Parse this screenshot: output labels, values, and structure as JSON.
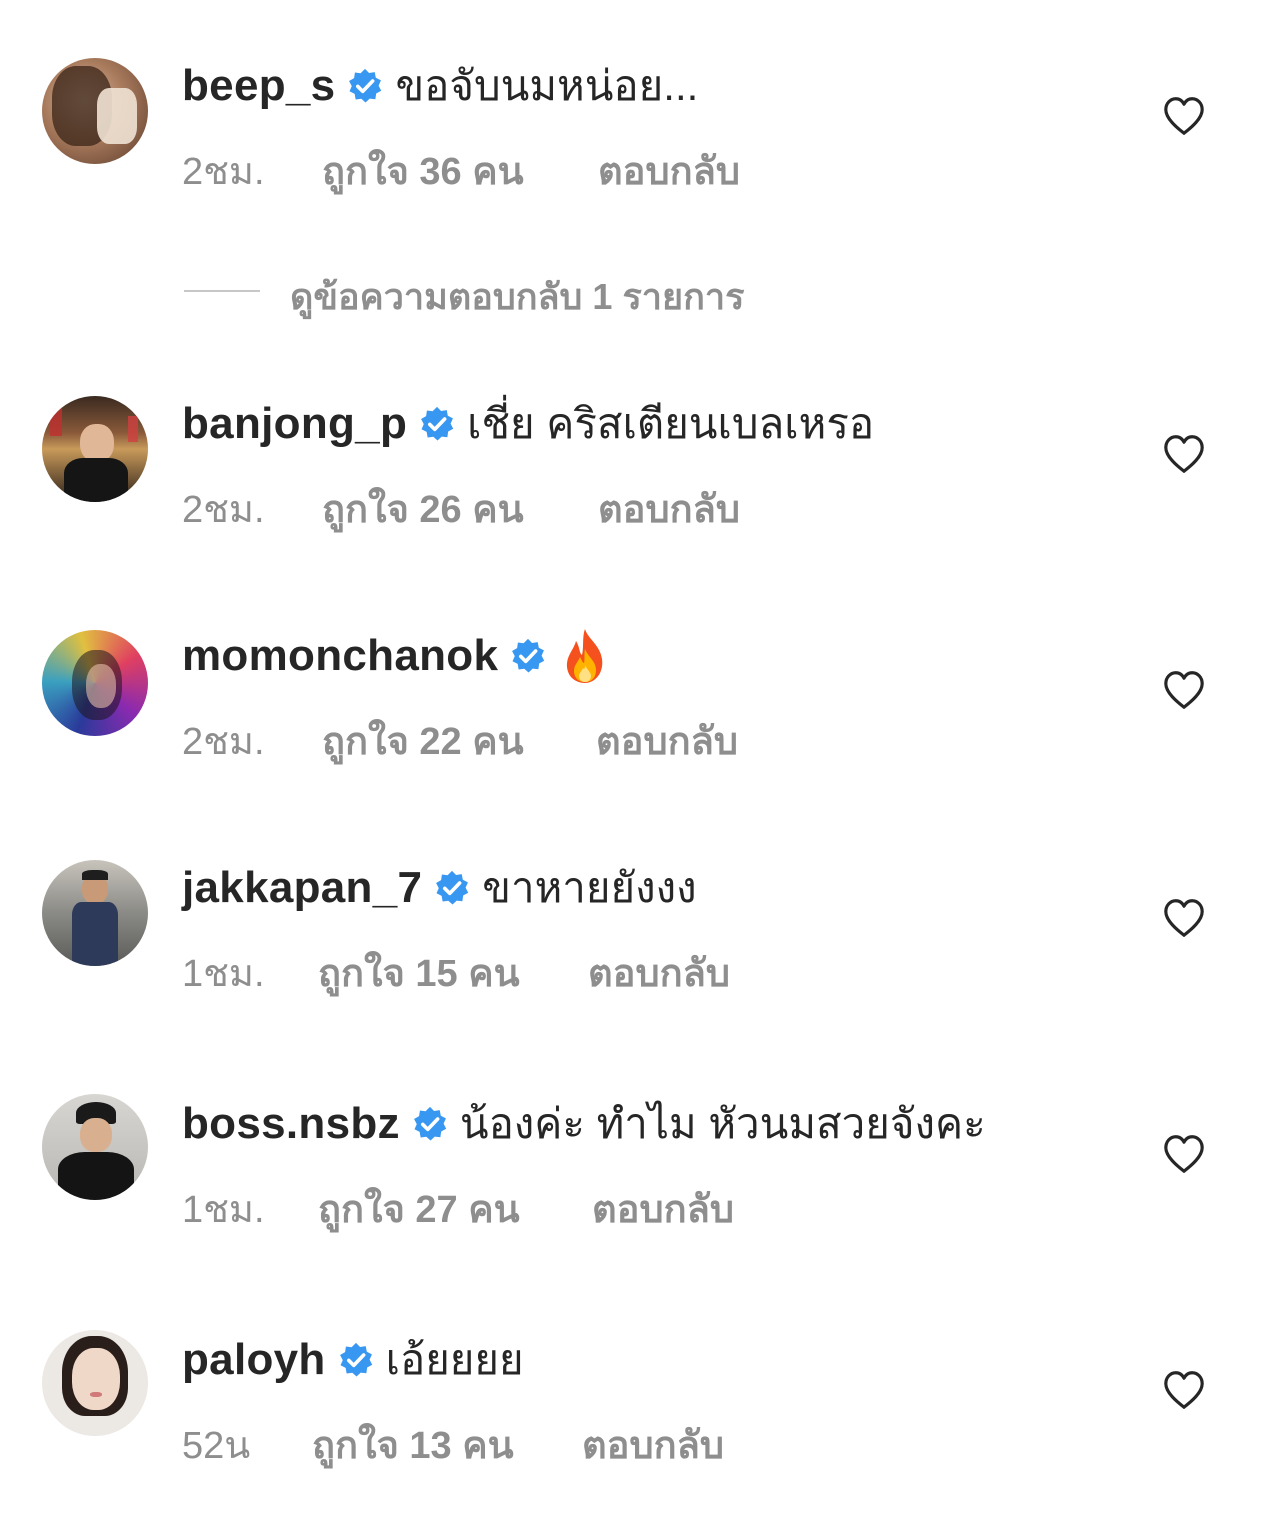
{
  "comments": [
    {
      "username": "beep_s",
      "text": "ขอจับนมหน่อย...",
      "time": "2ชม.",
      "likes": "ถูกใจ 36 คน",
      "reply": "ตอบกลับ",
      "view_replies": "ดูข้อความตอบกลับ 1 รายการ"
    },
    {
      "username": "banjong_p",
      "text": "เชี่ย คริสเตียนเบลเหรอ",
      "time": "2ชม.",
      "likes": "ถูกใจ 26 คน",
      "reply": "ตอบกลับ"
    },
    {
      "username": "momonchanok",
      "text": "",
      "emoji": "fire-emoji",
      "time": "2ชม.",
      "likes": "ถูกใจ 22 คน",
      "reply": "ตอบกลับ"
    },
    {
      "username": "jakkapan_7",
      "text": "ขาหายยังงง",
      "time": "1ชม.",
      "likes": "ถูกใจ 15 คน",
      "reply": "ตอบกลับ"
    },
    {
      "username": "boss.nsbz",
      "text": "น้องค่ะ ทำไม หัวนมสวยจังคะ",
      "time": "1ชม.",
      "likes": "ถูกใจ 27 คน",
      "reply": "ตอบกลับ"
    },
    {
      "username": "paloyh",
      "text": "เอ้ยยยย",
      "time": "52น",
      "likes": "ถูกใจ 13 คน",
      "reply": "ตอบกลับ"
    }
  ],
  "icons": {
    "verified": "verified-badge-icon",
    "like": "heart-outline-icon"
  },
  "colors": {
    "verified_blue": "#3897f0",
    "username": "#262626",
    "meta_gray": "#8e8e8e"
  }
}
